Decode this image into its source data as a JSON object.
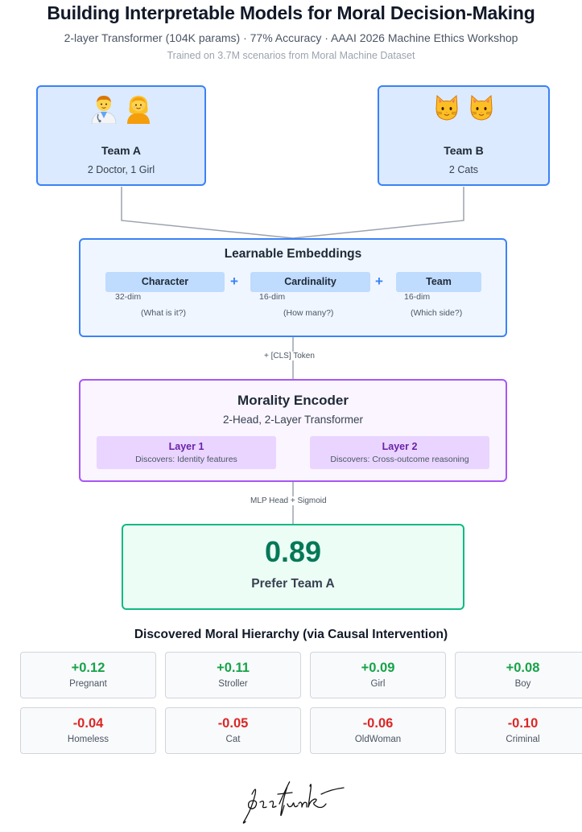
{
  "header": {
    "title": "Building Interpretable Models for Moral Decision-Making",
    "subtitle": "2-layer Transformer (104K params) · 77% Accuracy · AAAI 2026 Machine Ethics Workshop",
    "trained_on": "Trained on 3.7M scenarios from Moral Machine Dataset"
  },
  "team_a": {
    "name": "Team A",
    "composition": "2 Doctor, 1 Girl",
    "icons": [
      "man-doctor-icon",
      "girl-icon"
    ]
  },
  "team_b": {
    "name": "Team B",
    "composition": "2 Cats",
    "icons": [
      "cat-icon",
      "cat-icon"
    ]
  },
  "embeddings": {
    "title": "Learnable Embeddings",
    "components": [
      {
        "name": "Character",
        "dim": "32-dim",
        "question": "(What is it?)"
      },
      {
        "name": "Cardinality",
        "dim": "16-dim",
        "question": "(How many?)"
      },
      {
        "name": "Team",
        "dim": "16-dim",
        "question": "(Which side?)"
      }
    ],
    "operator": "+"
  },
  "connector_1": "+ [CLS] Token",
  "encoder": {
    "title": "Morality Encoder",
    "subtitle": "2-Head, 2-Layer Transformer",
    "layers": [
      {
        "name": "Layer 1",
        "desc": "Discovers: Identity features"
      },
      {
        "name": "Layer 2",
        "desc": "Discovers: Cross-outcome reasoning"
      }
    ]
  },
  "connector_2": "MLP Head + Sigmoid",
  "output": {
    "value": "0.89",
    "label": "Prefer Team A"
  },
  "hierarchy": {
    "title": "Discovered Moral Hierarchy (via Causal Intervention)",
    "items": [
      {
        "value": "+0.12",
        "label": "Pregnant"
      },
      {
        "value": "+0.11",
        "label": "Stroller"
      },
      {
        "value": "+0.09",
        "label": "Girl"
      },
      {
        "value": "+0.08",
        "label": "Boy"
      },
      {
        "value": "-0.04",
        "label": "Homeless"
      },
      {
        "value": "-0.05",
        "label": "Cat"
      },
      {
        "value": "-0.06",
        "label": "OldWoman"
      },
      {
        "value": "-0.10",
        "label": "Criminal"
      }
    ]
  },
  "logo": {
    "text": "lossfunk",
    "kind": "handwritten-logo"
  },
  "colors": {
    "blue_border": "#3b82f6",
    "purple_border": "#a855f7",
    "green_border": "#10b981",
    "positive": "#16a34a",
    "negative": "#dc2626"
  }
}
